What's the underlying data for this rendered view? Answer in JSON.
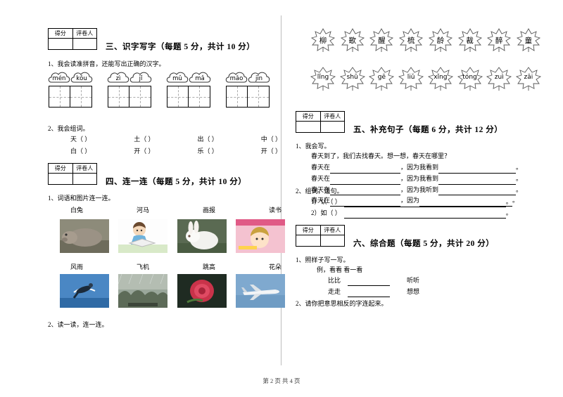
{
  "footer": "第 2 页 共 4 页",
  "score_labels": {
    "score": "得分",
    "grader": "评卷人"
  },
  "left": {
    "section3": {
      "title": "三、识字写字（每题 5 分，共计 10 分）",
      "q1": "1、我会读准拼音，还能写出正确的汉字。",
      "pinyin_groups": [
        [
          "mén",
          "kǒu"
        ],
        [
          "zì",
          "jǐ"
        ],
        [
          "mǔ",
          "mǎ"
        ],
        [
          "mǎo",
          "jīn"
        ]
      ],
      "q2": "2、我会组词。",
      "words": [
        [
          "天（      ）",
          "土（      ）",
          "出（      ）",
          "中（      ）"
        ],
        [
          "白（      ）",
          "开（      ）",
          "乐（      ）",
          "开（      ）"
        ]
      ]
    },
    "section4": {
      "title": "四、连一连（每题 5 分，共计 10 分）",
      "q1": "1、词语和图片连一连。",
      "words_top": [
        "白兔",
        "河马",
        "画报",
        "读书"
      ],
      "words_mid": [
        "风雨",
        "飞机",
        "跳高",
        "花朵"
      ],
      "q2": "2、读一读，连一连。"
    }
  },
  "right": {
    "leaves_top": [
      "柳",
      "歌",
      "醒",
      "梳",
      "龄",
      "裁",
      "醉",
      "童"
    ],
    "leaves_bottom": [
      "lǐng",
      "shū",
      "gē",
      "liǔ",
      "xǐng",
      "tóng",
      "zuì",
      "zāi"
    ],
    "section5": {
      "title": "五、补充句子（每题 6 分，共计 12 分）",
      "q1": "1、我会写。",
      "q1_prompt": "春天到了，我们去找春天。想一想，春天在哪里？",
      "q1_lines": [
        {
          "prefix": "春天在",
          "suffix": "，因为我看到"
        },
        {
          "prefix": "春天在",
          "suffix": "，因为我看到"
        },
        {
          "prefix": "春天在",
          "suffix": "，因为我听到"
        },
        {
          "prefix": "春天在",
          "suffix": "，因为"
        }
      ],
      "q2": "2、组词，造句。",
      "q2_items": [
        "1）认（      ）",
        "2）如（      ）"
      ]
    },
    "section6": {
      "title": "六、综合题（每题 5 分，共计 20 分）",
      "q1": "1、照样子写一写。",
      "q1_example": "例，看看          看一看",
      "q1_items": [
        {
          "word": "比比",
          "answer_label": "听听"
        },
        {
          "word": "走走",
          "answer_label": "想想"
        }
      ],
      "q2": "2、请你把意思相反的字连起来。"
    }
  }
}
